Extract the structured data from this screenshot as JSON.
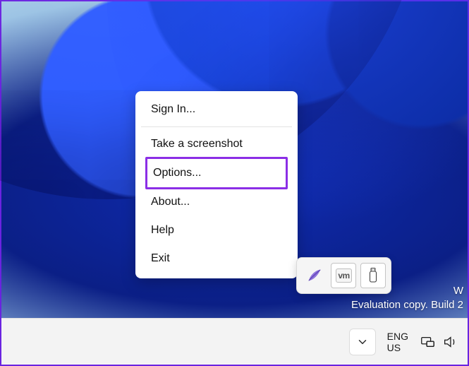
{
  "context_menu": {
    "items": [
      {
        "label": "Sign In...",
        "name": "menu-sign-in"
      },
      {
        "label": "Take a screenshot",
        "name": "menu-take-screenshot"
      },
      {
        "label": "Options...",
        "name": "menu-options",
        "highlighted": true
      },
      {
        "label": "About...",
        "name": "menu-about"
      },
      {
        "label": "Help",
        "name": "menu-help"
      },
      {
        "label": "Exit",
        "name": "menu-exit"
      }
    ]
  },
  "tray_popup": {
    "icons": [
      {
        "name": "app-feather-icon"
      },
      {
        "name": "vmware-tools-icon",
        "text": "vm"
      },
      {
        "name": "usb-device-icon"
      }
    ]
  },
  "watermark": {
    "line1": "W",
    "line2": "Evaluation copy. Build 2"
  },
  "taskbar": {
    "overflow_button": "Show hidden icons",
    "language": {
      "line1": "ENG",
      "line2": "US"
    },
    "system_icons": [
      {
        "name": "network-icon"
      },
      {
        "name": "volume-icon"
      }
    ]
  },
  "colors": {
    "highlight": "#8b2ee6"
  }
}
